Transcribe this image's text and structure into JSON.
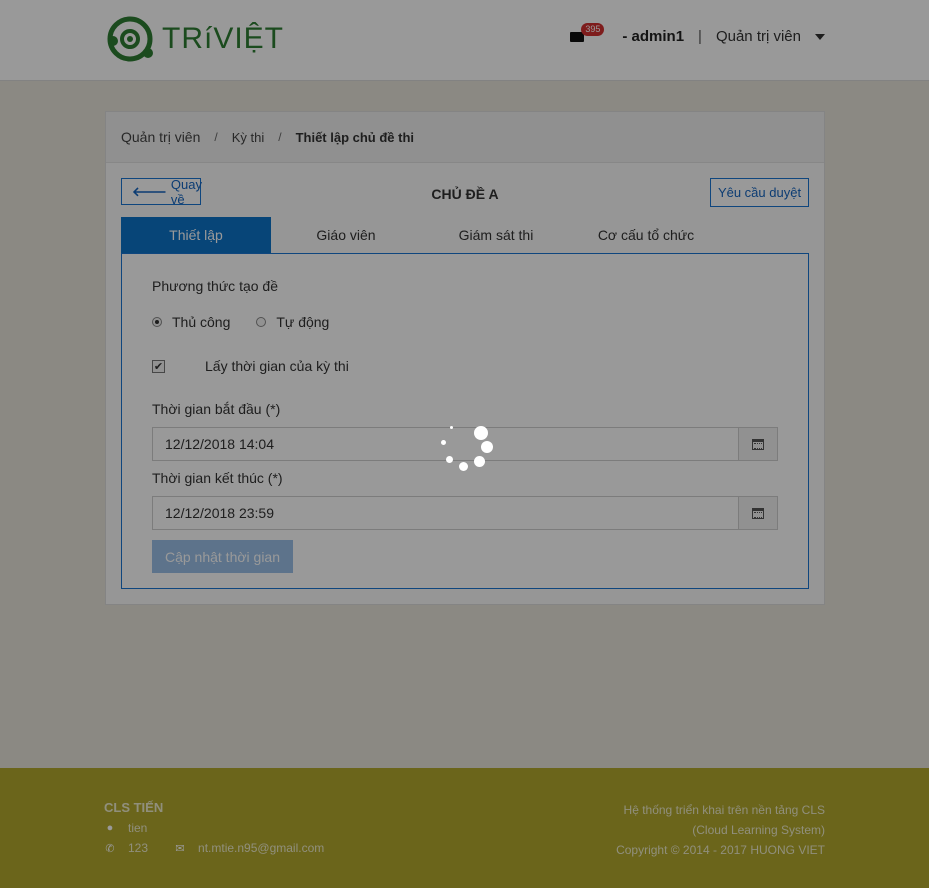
{
  "header": {
    "logo_text": "TRíVIỆT",
    "mail_count": "395",
    "username": "- admin1",
    "separator": "|",
    "role": "Quản trị viên"
  },
  "breadcrumb": {
    "items": [
      "Quản trị viên",
      "Kỳ thi",
      "Thiết lập chủ đề thi"
    ],
    "separator": "/"
  },
  "page": {
    "back_label": "Quay về",
    "title": "CHỦ ĐỀ A",
    "approve_label": "Yêu cầu duyệt"
  },
  "tabs": [
    {
      "label": "Thiết lập",
      "active": true
    },
    {
      "label": "Giáo viên",
      "active": false
    },
    {
      "label": "Giám sát thi",
      "active": false
    },
    {
      "label": "Cơ cấu tổ chức",
      "active": false
    }
  ],
  "form": {
    "method_label": "Phương thức tạo đề",
    "radio_manual": "Thủ công",
    "radio_auto": "Tự động",
    "selected_method": "Thủ công",
    "checkbox_label": "Lấy thời gian của kỳ thi",
    "checkbox_checked": true,
    "start_label": "Thời gian bắt đầu (*)",
    "start_value": "12/12/2018 14:04",
    "end_label": "Thời gian kết thúc (*)",
    "end_value": "12/12/2018 23:59",
    "update_button": "Cập nhật thời gian"
  },
  "footer": {
    "org_name": "CLS TIẾN",
    "address": "tien",
    "phone": "123",
    "email": "nt.mtie.n95@gmail.com",
    "line1": "Hệ thống triển khai trên nền tảng CLS",
    "line2": "(Cloud Learning System)",
    "copyright": "Copyright © 2014 - 2017 HUONG VIET"
  },
  "colors": {
    "primary": "#0d73c9",
    "logo_green": "#2e7d32",
    "footer_bg": "#b3a92d",
    "badge": "#d32f2f"
  }
}
